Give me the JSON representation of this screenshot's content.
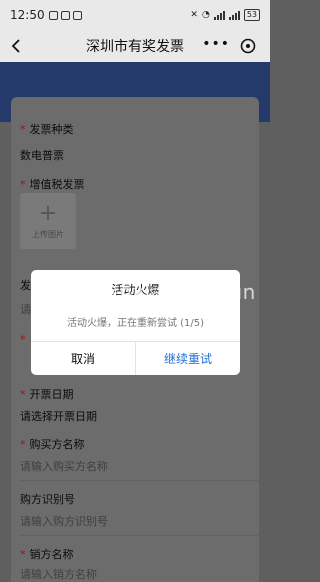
{
  "status_bar": {
    "time": "12:50",
    "battery": "53"
  },
  "nav": {
    "title": "深圳市有奖发票",
    "more": "•••"
  },
  "form": {
    "invoice_type_label": "发票种类",
    "invoice_type_value": "数电普票",
    "vat_label": "增值税发票",
    "upload_text": "上传图片",
    "hidden_label_fragment": "发",
    "hidden_placeholder_fragment": "请",
    "invoice_date_label": "开票日期",
    "invoice_date_placeholder": "请选择开票日期",
    "buyer_name_label": "购买方名称",
    "buyer_name_placeholder": "请输入购买方名称",
    "buyer_id_label": "购方识别号",
    "buyer_id_placeholder": "请输入购方识别号",
    "seller_name_label": "销方名称",
    "seller_name_placeholder": "请输入销方名称",
    "required_mark": "*"
  },
  "dialog": {
    "title": "活动火爆",
    "message": "活动火爆，正在重新尝试 (1/5)",
    "cancel": "取消",
    "retry": "继续重试"
  },
  "watermark": "线报酷-nxianbao.fun"
}
